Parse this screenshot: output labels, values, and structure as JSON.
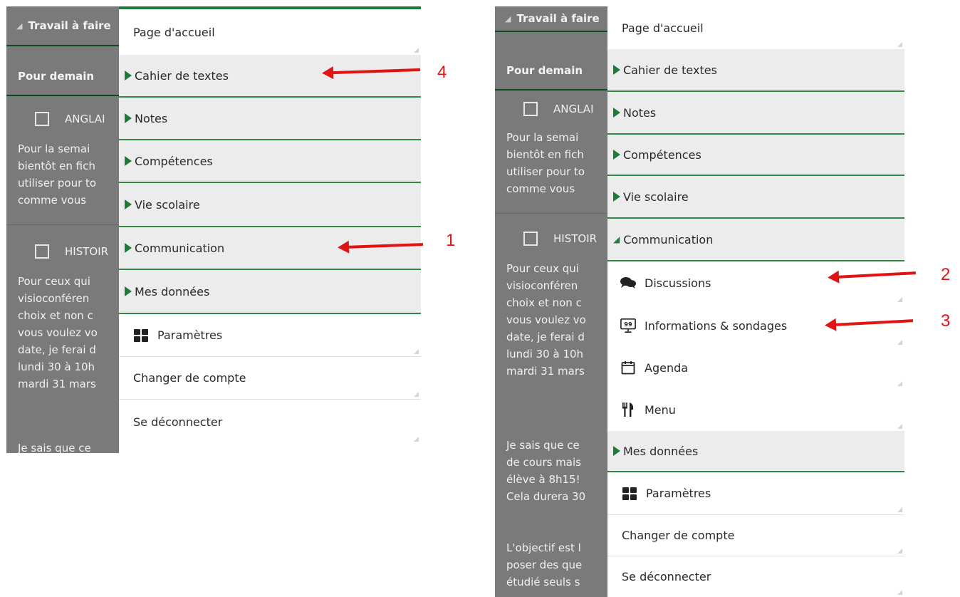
{
  "background": {
    "header": "Travail à faire",
    "subheader": "Pour demain",
    "task1_subject": "ANGLAI",
    "task1_lines": "Pour la semai\nbientôt en fich\nutiliser pour to\ncomme vous",
    "task2_subject": "HISTOIR",
    "task2_lines": "Pour ceux qui\nvisioconféren\nchoix et non c\nvous voulez vo\ndate, je ferai d\nlundi 30 à 10h\nmardi 31 mars",
    "left_tail": "Je sais que ce",
    "right_tail": "Je sais que ce\nde cours mais\nélève à 8h15!\nCela durera 30",
    "right_tail2": "L'objectif est l\nposer des que\nétudié seuls s"
  },
  "menu": {
    "home": "Page d'accueil",
    "cahier": "Cahier de textes",
    "notes": "Notes",
    "competences": "Compétences",
    "vie_scolaire": "Vie scolaire",
    "communication": "Communication",
    "discussions": "Discussions",
    "informations": "Informations & sondages",
    "agenda": "Agenda",
    "menu_cantine": "Menu",
    "mes_donnees": "Mes données",
    "parametres": "Paramètres",
    "changer": "Changer de compte",
    "deconnecter": "Se déconnecter"
  },
  "annotations": {
    "n1": "1",
    "n2": "2",
    "n3": "3",
    "n4": "4"
  },
  "colors": {
    "accent": "#1e7a37",
    "annotation": "#e01414",
    "section_bg": "#ececec"
  }
}
